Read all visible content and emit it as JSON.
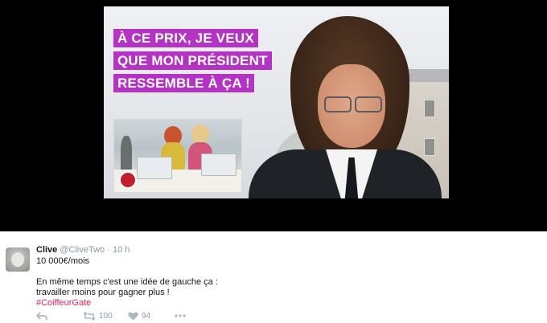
{
  "media": {
    "headline_lines": [
      "À CE PRIX, JE VEUX",
      "QUE MON PRÉSIDENT",
      "RESSEMBLE À ÇA !"
    ],
    "accent_color": "#b533c4"
  },
  "tweet": {
    "author_name": "Clive",
    "author_handle": "@CliveTwo",
    "separator": "·",
    "timestamp": "10 h",
    "lines": [
      "10 000€/mois",
      "En même temps c'est une idée de gauche ça :",
      "travailler moins pour gagner plus !"
    ],
    "hashtag": "#CoiffeurGate",
    "hashtag_color": "#e0245e",
    "actions": {
      "reply_icon": "reply-icon",
      "retweet_icon": "retweet-icon",
      "retweet_count": "100",
      "like_icon": "heart-icon",
      "like_count": "94",
      "more_icon": "more-icon"
    }
  }
}
